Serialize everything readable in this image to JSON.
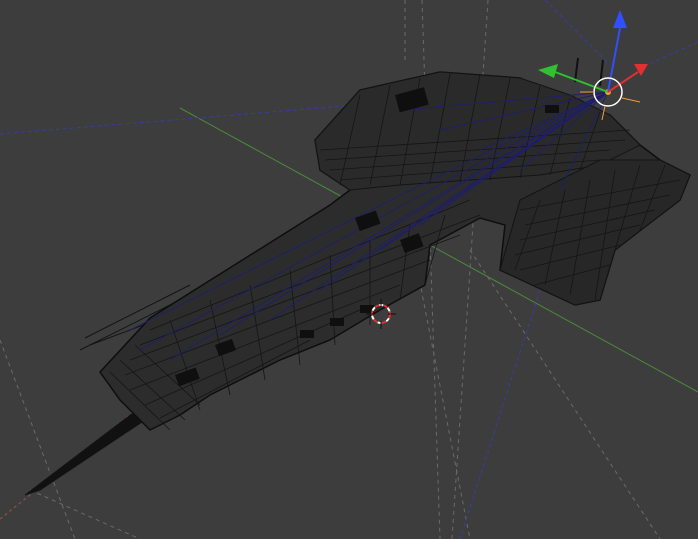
{
  "viewport": {
    "mode": "wireframe",
    "background_color": "#3d3d3d",
    "x_axis_color": "#a05050",
    "y_axis_color": "#4a8a3a",
    "z_axis_color": "#3a3aa8",
    "wire_color": "#141414",
    "selected_wire_color": "#1e1e6e",
    "origin_color": "#f4a030"
  },
  "gizmo": {
    "x_color": "#e03030",
    "y_color": "#30c030",
    "z_color": "#3050ff",
    "ring_color": "#ffffff",
    "arrows": [
      "x-arrow-icon",
      "y-arrow-icon",
      "z-arrow-icon"
    ]
  },
  "cursor_3d": {
    "icon": "crosshair-icon",
    "colors": [
      "#e03030",
      "#ffffff"
    ]
  },
  "model": {
    "type": "spaceship-mesh",
    "selected": true
  }
}
